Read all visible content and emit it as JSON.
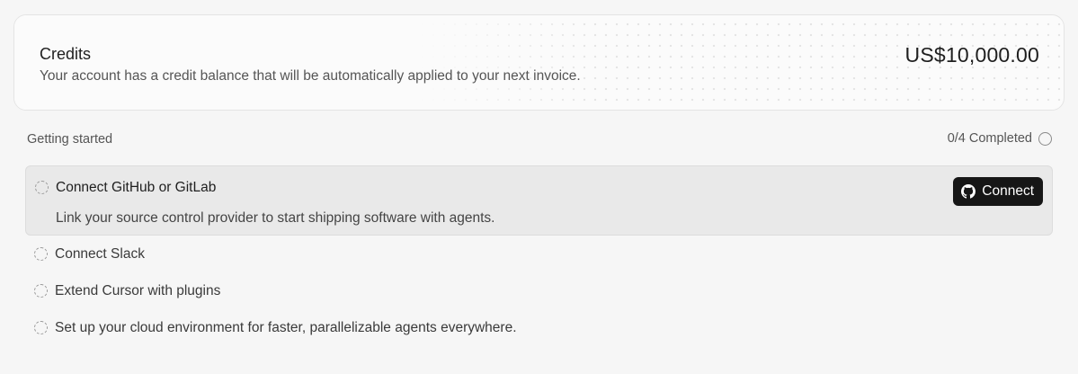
{
  "credits": {
    "title": "Credits",
    "description": "Your account has a credit balance that will be automatically applied to your next invoice.",
    "amount": "US$10,000.00"
  },
  "getting_started": {
    "label": "Getting started",
    "progress": "0/4 Completed",
    "tasks": [
      {
        "title": "Connect GitHub or GitLab",
        "description": "Link your source control provider to start shipping software with agents.",
        "button_label": "Connect",
        "button_icon": "github-icon",
        "status_icon": "dashed-circle-icon"
      },
      {
        "title": "Connect Slack",
        "status_icon": "dashed-circle-icon"
      },
      {
        "title": "Extend Cursor with plugins",
        "status_icon": "dashed-circle-icon"
      },
      {
        "title": "Set up your cloud environment for faster, parallelizable agents everywhere.",
        "status_icon": "dashed-circle-icon"
      }
    ]
  },
  "colors": {
    "background": "#f6f6f6",
    "active_task_bg": "#e9e9e9",
    "button_bg": "#161616",
    "button_text": "#ffffff"
  }
}
